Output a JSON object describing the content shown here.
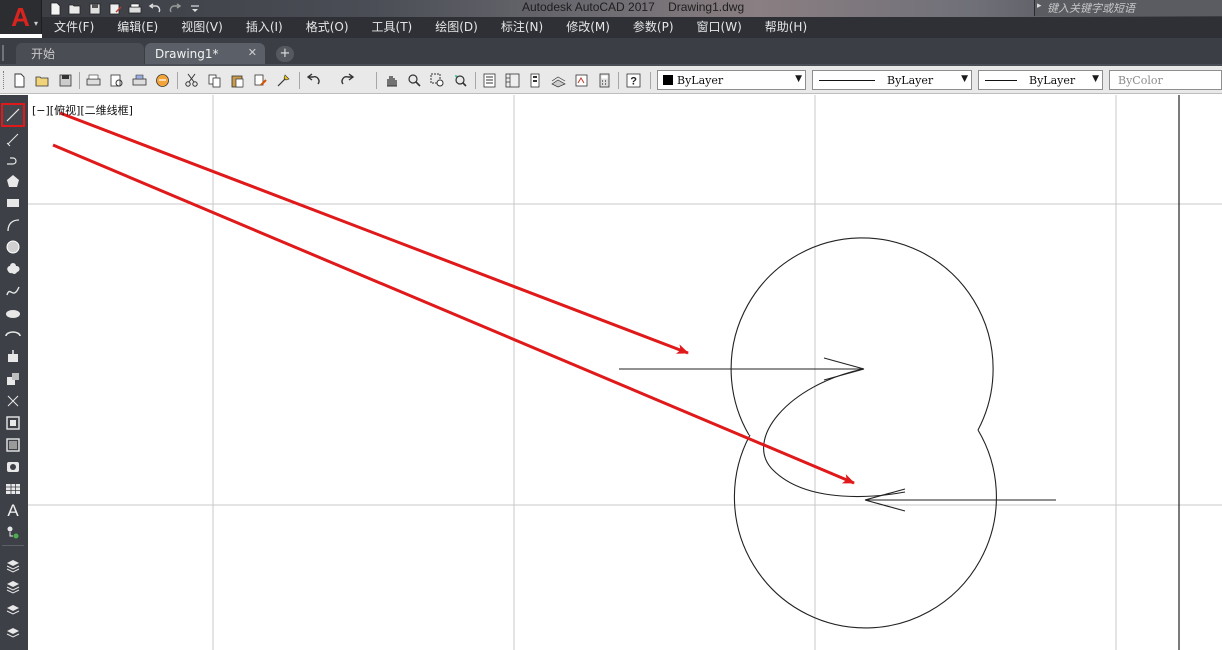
{
  "window": {
    "title": "Autodesk AutoCAD 2017    Drawing1.dwg",
    "search_placeholder": "键入关键字或短语"
  },
  "quick_access": [
    "new-icon",
    "open-icon",
    "save-icon",
    "saveas-icon",
    "print-icon",
    "undo-icon",
    "redo-icon",
    "customize-icon"
  ],
  "menu": {
    "items": [
      "文件(F)",
      "编辑(E)",
      "视图(V)",
      "插入(I)",
      "格式(O)",
      "工具(T)",
      "绘图(D)",
      "标注(N)",
      "修改(M)",
      "参数(P)",
      "窗口(W)",
      "帮助(H)"
    ]
  },
  "tabs": {
    "start": "开始",
    "drawing": "Drawing1*",
    "close": "✕",
    "new": "+"
  },
  "properties": {
    "color": "ByLayer",
    "linetype": "ByLayer",
    "lineweight": "ByLayer",
    "plotstyle": "ByColor"
  },
  "viewport": {
    "label": "[−][俯视][二维线框]"
  },
  "left_tools": [
    "line-icon",
    "xline-icon",
    "polyline-icon",
    "polygon-icon",
    "rectangle-icon",
    "arc-icon",
    "circle-icon",
    "revcloud-icon",
    "spline-icon",
    "ellipse-icon",
    "ellipse-arc-icon",
    "insert-block-icon",
    "make-block-icon",
    "point-icon",
    "hatch-icon",
    "gradient-icon",
    "region-icon",
    "table-icon",
    "mtext-icon",
    "add-selected-icon",
    "layer-tools-icons"
  ],
  "colors": {
    "annotation_arrow": "#e0191a",
    "canvas_bg": "#ffffff",
    "grid": "#c8c8c8",
    "ui_dark": "#2e3035"
  }
}
